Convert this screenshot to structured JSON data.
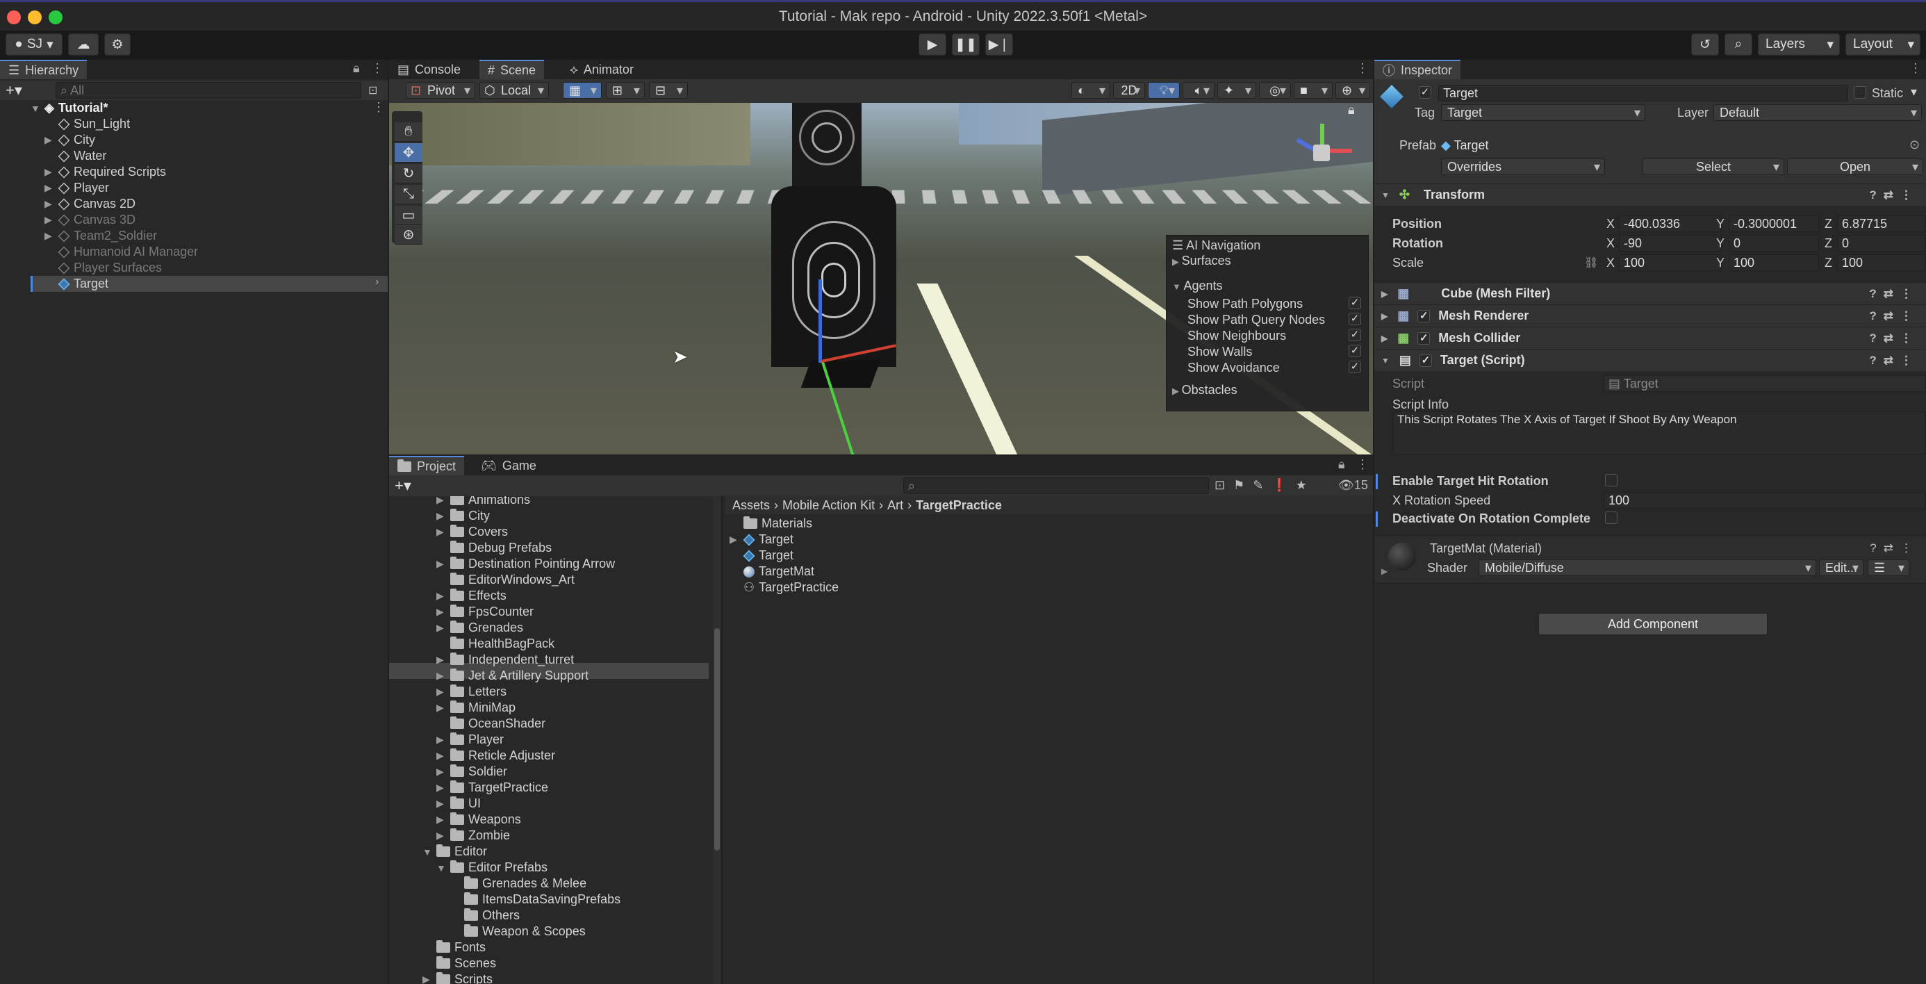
{
  "window": {
    "title": "Tutorial - Mak repo - Android - Unity 2022.3.50f1 <Metal>"
  },
  "toolbar": {
    "account": "SJ",
    "layers": "Layers",
    "layout": "Layout"
  },
  "hierarchy": {
    "tab": "Hierarchy",
    "search_placeholder": "All",
    "scene": "Tutorial*",
    "items": [
      {
        "label": "Sun_Light"
      },
      {
        "label": "City"
      },
      {
        "label": "Water"
      },
      {
        "label": "Required Scripts"
      },
      {
        "label": "Player"
      },
      {
        "label": "Canvas 2D"
      },
      {
        "label": "Canvas 3D"
      },
      {
        "label": "Team2_Soldier"
      },
      {
        "label": "Humanoid AI Manager"
      },
      {
        "label": "Player Surfaces"
      },
      {
        "label": "Target"
      }
    ]
  },
  "scene_tabs": {
    "console": "Console",
    "scene": "Scene",
    "animator": "Animator"
  },
  "scene_toolbar": {
    "pivot": "Pivot",
    "local": "Local",
    "mode_2d": "2D"
  },
  "ai_navigation": {
    "title": "AI Navigation",
    "surfaces": "Surfaces",
    "agents": "Agents",
    "options": [
      "Show Path Polygons",
      "Show Path Query Nodes",
      "Show Neighbours",
      "Show Walls",
      "Show Avoidance"
    ],
    "obstacles": "Obstacles"
  },
  "bottom_tabs": {
    "project": "Project",
    "game": "Game",
    "count": "15"
  },
  "project_tree": [
    "Animations",
    "City",
    "Covers",
    "Debug Prefabs",
    "Destination Pointing Arrow",
    "EditorWindows_Art",
    "Effects",
    "FpsCounter",
    "Grenades",
    "HealthBagPack",
    "Independent_turret",
    "Jet & Artillery Support",
    "Letters",
    "MiniMap",
    "OceanShader",
    "Player",
    "Reticle Adjuster",
    "Soldier",
    "TargetPractice",
    "UI",
    "Weapons",
    "Zombie"
  ],
  "project_tree_editor": {
    "editor": "Editor",
    "editor_prefabs": "Editor Prefabs",
    "sub": [
      "Grenades & Melee",
      "ItemsDataSavingPrefabs",
      "Others",
      "Weapon & Scopes"
    ],
    "fonts": "Fonts",
    "scenes": "Scenes",
    "scripts": "Scripts"
  },
  "breadcrumb": [
    "Assets",
    "Mobile Action Kit",
    "Art",
    "TargetPractice"
  ],
  "assets": [
    "Materials",
    "Target",
    "Target",
    "TargetMat",
    "TargetPractice"
  ],
  "inspector": {
    "tab": "Inspector",
    "name": "Target",
    "static": "Static",
    "tag_label": "Tag",
    "tag": "Target",
    "layer_label": "Layer",
    "layer": "Default",
    "prefab_label": "Prefab",
    "prefab": "Target",
    "overrides": "Overrides",
    "select": "Select",
    "open": "Open",
    "transform": {
      "title": "Transform",
      "position": "Position",
      "rotation": "Rotation",
      "scale": "Scale",
      "pos": [
        "-400.0336",
        "-0.3000001",
        "6.87715"
      ],
      "rot": [
        "-90",
        "0",
        "0"
      ],
      "scl": [
        "100",
        "100",
        "100"
      ]
    },
    "axis": [
      "X",
      "Y",
      "Z"
    ],
    "components": [
      "Cube (Mesh Filter)",
      "Mesh Renderer",
      "Mesh Collider",
      "Target (Script)"
    ],
    "script_label": "Script",
    "script": "Target",
    "script_info_label": "Script Info",
    "script_info": "This Script Rotates The X Axis of Target If Shoot By Any Weapon",
    "enable_hit": "Enable Target Hit Rotation",
    "x_rot_speed_label": "X Rotation Speed",
    "x_rot_speed": "100",
    "deactivate": "Deactivate On Rotation Complete",
    "material": "TargetMat (Material)",
    "shader_label": "Shader",
    "shader": "Mobile/Diffuse",
    "edit": "Edit...",
    "add_component": "Add Component"
  }
}
